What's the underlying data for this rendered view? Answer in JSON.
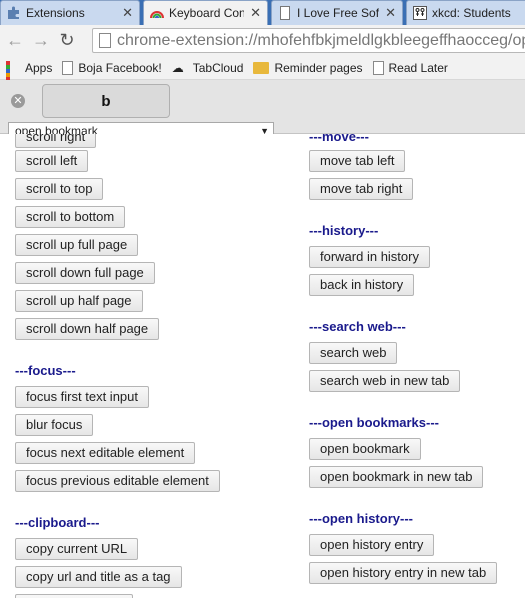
{
  "tabs": [
    {
      "title": "Extensions",
      "favicon": "puzzle-icon",
      "active": false
    },
    {
      "title": "Keyboard Con",
      "favicon": "rainbow-icon",
      "active": true
    },
    {
      "title": "I Love Free Sof",
      "favicon": "page-icon",
      "active": false
    },
    {
      "title": "xkcd: Students",
      "favicon": "xkcd-icon",
      "active": false
    }
  ],
  "toolbar": {
    "url": "chrome-extension://mhofehfbkjmeldlgkbleegeffhaocceg/op"
  },
  "bookmarks": [
    {
      "label": "Apps",
      "icon": "apps-grid-icon"
    },
    {
      "label": "Boja Facebook!",
      "icon": "page-icon"
    },
    {
      "label": "TabCloud",
      "icon": "cloud-icon"
    },
    {
      "label": "Reminder pages",
      "icon": "folder-icon"
    },
    {
      "label": "Read Later",
      "icon": "page-icon"
    }
  ],
  "popup": {
    "key": "b",
    "selected_action": "open bookmark"
  },
  "left": {
    "scroll_top_cut": "scroll right",
    "scroll": [
      "scroll left",
      "scroll to top",
      "scroll to bottom",
      "scroll up full page",
      "scroll down full page",
      "scroll up half page",
      "scroll down half page"
    ],
    "focus_heading": "---focus---",
    "focus": [
      "focus first text input",
      "blur focus",
      "focus next editable element",
      "focus previous editable element"
    ],
    "clipboard_heading": "---clipboard---",
    "clipboard": [
      "copy current URL",
      "copy url and title as a tag"
    ]
  },
  "right": {
    "move_heading": "---move---",
    "move": [
      "move tab left",
      "move tab right"
    ],
    "history_heading": "---history---",
    "history": [
      "forward in history",
      "back in history"
    ],
    "search_heading": "---search web---",
    "search": [
      "search web",
      "search web in new tab"
    ],
    "bookmarks_heading": "---open bookmarks---",
    "bookmarks": [
      "open bookmark",
      "open bookmark in new tab"
    ],
    "openhistory_heading": "---open history---",
    "openhistory": [
      "open history entry",
      "open history entry in new tab"
    ]
  },
  "colors": {
    "heading": "#1a1a8c",
    "tabstrip": "#3a6fb4"
  }
}
